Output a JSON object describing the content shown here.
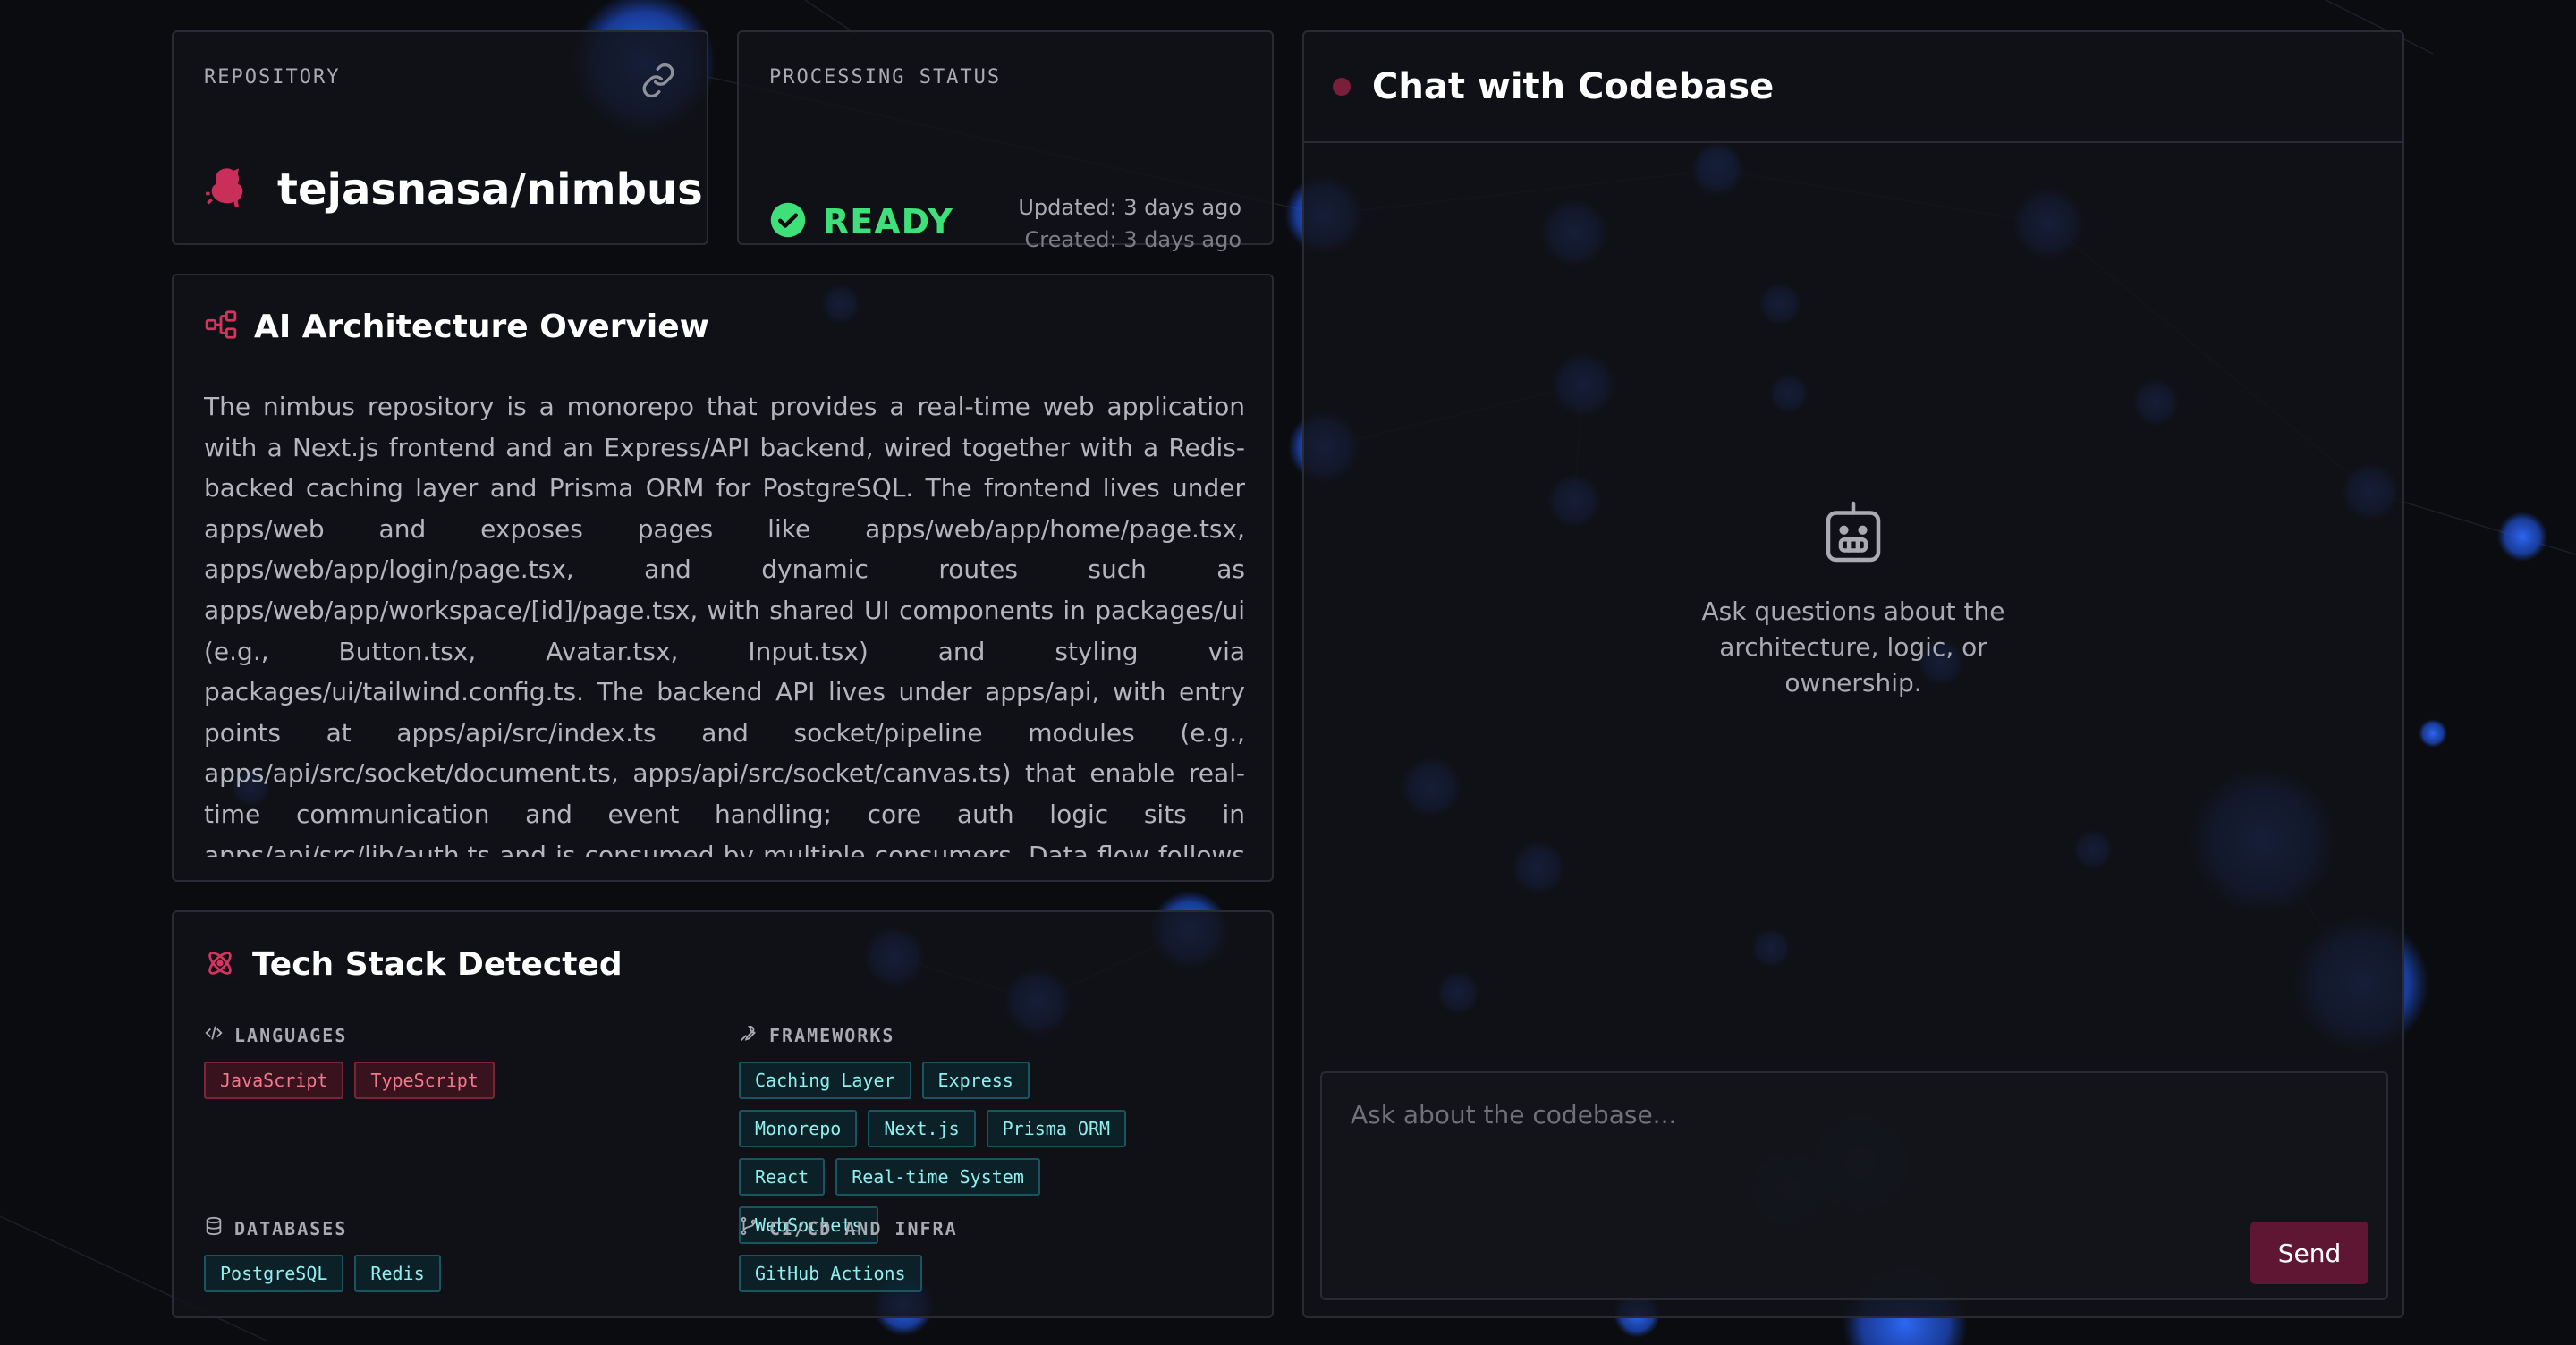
{
  "colors": {
    "background": "#0b0c10",
    "panel": "#121318",
    "border": "#2a2b32",
    "accent_red": "#d4345e",
    "ready_green": "#3ee07a",
    "tag_red": "#f07a8c",
    "tag_cyan": "#8ff0f0",
    "send_button": "#5e1632"
  },
  "repository": {
    "label": "REPOSITORY",
    "name": "tejasnasa/nimbus",
    "icons": [
      "link-icon",
      "github-icon"
    ]
  },
  "status": {
    "label": "PROCESSING STATUS",
    "value": "READY",
    "updated": "Updated: 3 days ago",
    "created": "Created: 3 days ago",
    "icon": "check-circle-icon"
  },
  "architecture": {
    "title": "AI Architecture Overview",
    "icon": "hierarchy-icon",
    "text": "The nimbus repository is a monorepo that provides a real-time web application with a Next.js frontend and an Express/API backend, wired together with a Redis-backed caching layer and Prisma ORM for PostgreSQL. The frontend lives under apps/web and exposes pages like apps/web/app/home/page.tsx, apps/web/app/login/page.tsx, and dynamic routes such as apps/web/app/workspace/[id]/page.tsx, with shared UI components in packages/ui (e.g., Button.tsx, Avatar.tsx, Input.tsx) and styling via packages/ui/tailwind.config.ts. The backend API lives under apps/api, with entry points at apps/api/src/index.ts and socket/pipeline modules (e.g., apps/api/src/socket/document.ts, apps/api/src/socket/canvas.ts) that enable real-time communication and event handling; core auth logic sits in apps/api/src/lib/auth.ts and is consumed by multiple consumers. Data flow follows a clear hop-based model: API entry (apps/api/src/index.ts) dispatches to socket/document.ts, socket/"
  },
  "tech_stack": {
    "title": "Tech Stack Detected",
    "icon": "atom-icon",
    "languages": {
      "label": "LANGUAGES",
      "icon": "code-icon",
      "items": [
        "JavaScript",
        "TypeScript"
      ]
    },
    "frameworks": {
      "label": "FRAMEWORKS",
      "icon": "wrench-icon",
      "items": [
        "Caching Layer",
        "Express",
        "Monorepo",
        "Next.js",
        "Prisma ORM",
        "React",
        "Real-time System",
        "WebSockets"
      ]
    },
    "databases": {
      "label": "DATABASES",
      "icon": "database-icon",
      "items": [
        "PostgreSQL",
        "Redis"
      ]
    },
    "cicd": {
      "label": "CI/CD AND INFRA",
      "icon": "git-branch-icon",
      "items": [
        "GitHub Actions"
      ]
    }
  },
  "chat": {
    "title": "Chat with Codebase",
    "empty_icon": "robot-icon",
    "empty_text": "Ask questions about the architecture, logic, or ownership.",
    "input_placeholder": "Ask about the codebase...",
    "send_label": "Send"
  }
}
